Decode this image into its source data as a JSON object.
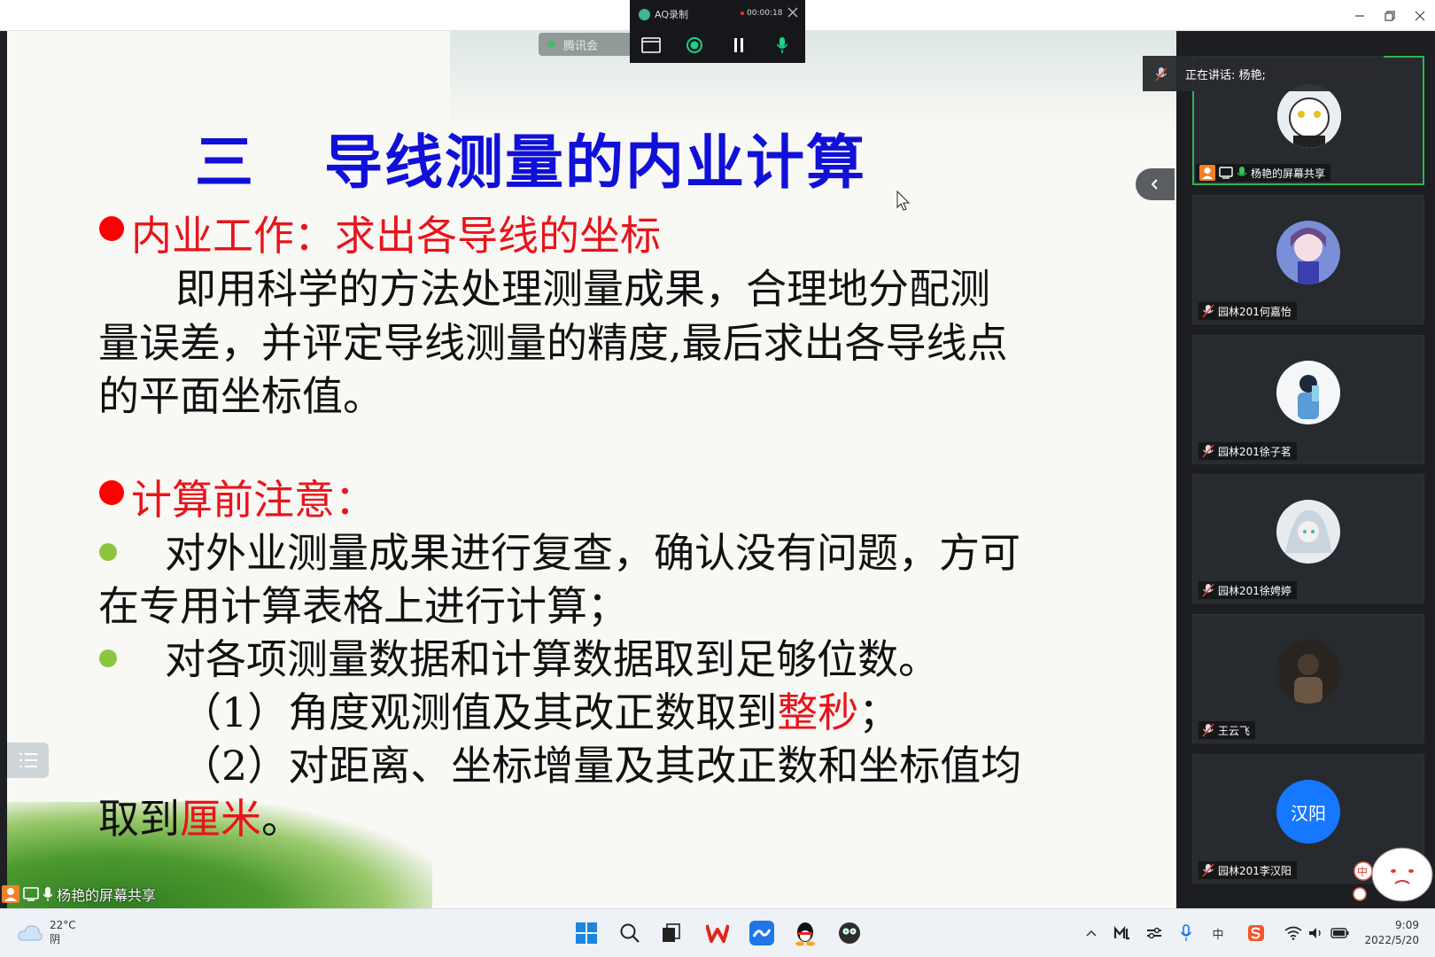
{
  "recorder": {
    "app_name": "AQ录制",
    "timer": "00:00:18"
  },
  "slide": {
    "meeting_chip": "腾讯会",
    "title_number": "三",
    "title": "导线测量的内业计算",
    "section1_heading": "内业工作：求出各导线的坐标",
    "section1_line1": "即用科学的方法处理测量成果，合理地分配测",
    "section1_line2": "量误差，并评定导线测量的精度,最后求出各导线点",
    "section1_line3": "的平面坐标值。",
    "section2_heading": "计算前注意：",
    "bullet1_line1": "对外业测量成果进行复查，确认没有问题，方可",
    "bullet1_line2": "在专用计算表格上进行计算；",
    "bullet2": "对各项测量数据和计算数据取到足够位数。",
    "item1_prefix": "（1）角度观测值及其改正数取到",
    "item1_highlight": "整秒",
    "item1_suffix": "；",
    "item2_line1": "（2）对距离、坐标增量及其改正数和坐标值均",
    "item2_line2_prefix": "取到",
    "item2_line2_highlight": "厘米",
    "item2_line2_suffix": "。",
    "share_label": "杨艳的屏幕共享",
    "colors": {
      "title": "#1010d8",
      "heading": "#e8141b",
      "bullet_green": "#8cc63e"
    }
  },
  "panel": {
    "speaking": "正在讲话: 杨艳;",
    "participants": [
      {
        "name": "杨艳的屏幕共享",
        "avatar_text": ""
      },
      {
        "name": "园林201何嘉怡",
        "avatar_text": ""
      },
      {
        "name": "园林201徐子茗",
        "avatar_text": ""
      },
      {
        "name": "园林201徐娉婷",
        "avatar_text": ""
      },
      {
        "name": "王云飞",
        "avatar_text": ""
      },
      {
        "name": "园林201李汉阳",
        "avatar_text": "汉阳"
      }
    ],
    "sticker_char": "中"
  },
  "taskbar": {
    "temperature": "22°C",
    "weather": "阴",
    "time": "9:09",
    "date": "2022/5/20",
    "tray_ime": "中"
  }
}
